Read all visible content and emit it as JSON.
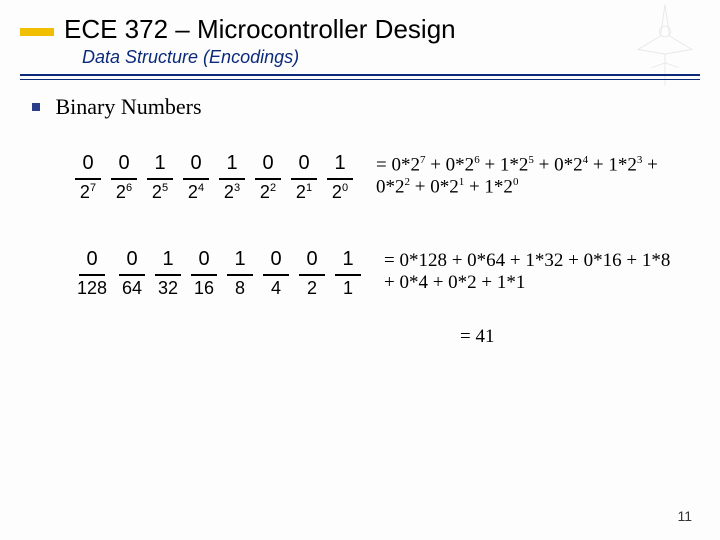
{
  "header": {
    "title": "ECE 372 – Microcontroller Design",
    "subtitle": "Data Structure (Encodings)"
  },
  "bullet": "Binary Numbers",
  "row1": {
    "bits": [
      "0",
      "0",
      "1",
      "0",
      "1",
      "0",
      "0",
      "1"
    ],
    "weights_base": [
      "2",
      "2",
      "2",
      "2",
      "2",
      "2",
      "2",
      "2"
    ],
    "weights_exp": [
      "7",
      "6",
      "5",
      "4",
      "3",
      "2",
      "1",
      "0"
    ],
    "equation_pre": "= ",
    "equation": "0*2<sup>7</sup> + 0*2<sup>6</sup> + 1*2<sup>5</sup> + 0*2<sup>4</sup> + 1*2<sup>3</sup> + 0*2<sup>2</sup> + 0*2<sup>1</sup> + 1*2<sup>0</sup>"
  },
  "row2": {
    "bits": [
      "0",
      "0",
      "1",
      "0",
      "1",
      "0",
      "0",
      "1"
    ],
    "weights": [
      "128",
      "64",
      "32",
      "16",
      "8",
      "4",
      "2",
      "1"
    ],
    "equation_pre": "= ",
    "equation": "0*128 + 0*64 + 1*32 + 0*16 + 1*8 + 0*4 + 0*2 + 1*1"
  },
  "result": "= 41",
  "page_number": "11"
}
